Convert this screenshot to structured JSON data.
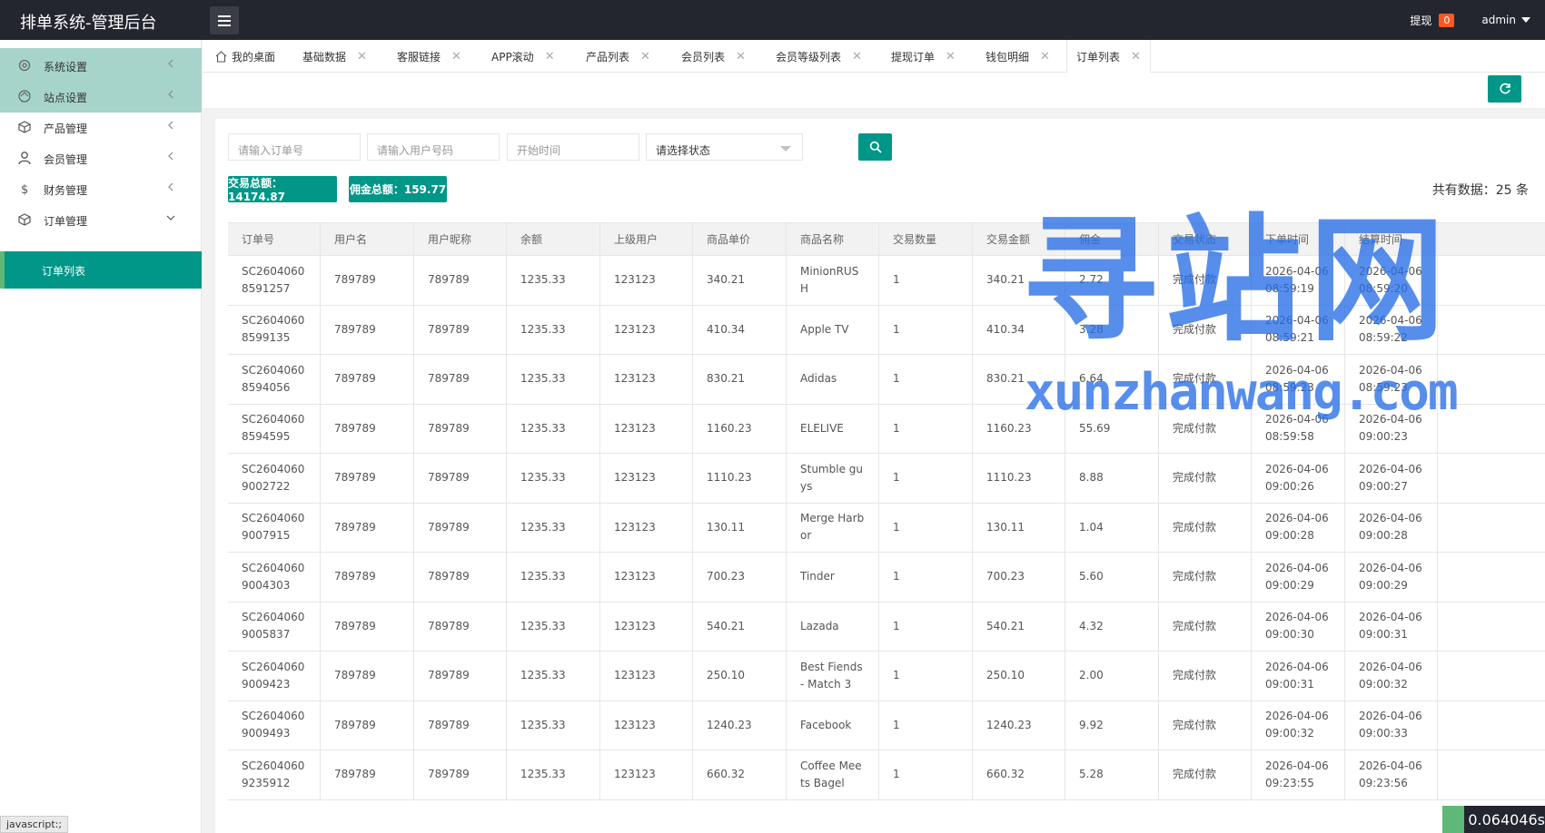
{
  "app": {
    "title": "排单系统-管理后台"
  },
  "header": {
    "withdraw_label": "提现",
    "withdraw_count": "0",
    "user": "admin"
  },
  "sidebar": {
    "items": [
      {
        "label": "系统设置",
        "icon": "gear-icon"
      },
      {
        "label": "站点设置",
        "icon": "site-icon"
      },
      {
        "label": "产品管理",
        "icon": "box-icon"
      },
      {
        "label": "会员管理",
        "icon": "user-icon"
      },
      {
        "label": "财务管理",
        "icon": "dollar-icon"
      },
      {
        "label": "订单管理",
        "icon": "box-icon"
      }
    ],
    "active_sub": "订单列表"
  },
  "tabs": [
    "我的桌面",
    "基础数据",
    "客服链接",
    "APP滚动",
    "产品列表",
    "会员列表",
    "会员等级列表",
    "提现订单",
    "钱包明细",
    "订单列表"
  ],
  "filters": {
    "order_no_placeholder": "请输入订单号",
    "phone_placeholder": "请输入用户号码",
    "start_placeholder": "开始时间",
    "status_value": "请选择状态"
  },
  "summary": {
    "trade_total": "交易总额：14174.87",
    "commission_total": "佣金总额：159.77",
    "count": "共有数据：25 条"
  },
  "table": {
    "headers": [
      "订单号",
      "用户名",
      "用户昵称",
      "余额",
      "上级用户",
      "商品单价",
      "商品名称",
      "交易数量",
      "交易金额",
      "佣金",
      "交易状态",
      "下单时间",
      "结算时间"
    ],
    "rows": [
      [
        "SC26040608591257",
        "789789",
        "789789",
        "1235.33",
        "123123",
        "340.21",
        "MinionRUSH",
        "1",
        "340.21",
        "2.72",
        "完成付款",
        "2026-04-06 08:59:19",
        "2026-04-06 08:59:20"
      ],
      [
        "SC26040608599135",
        "789789",
        "789789",
        "1235.33",
        "123123",
        "410.34",
        "Apple TV",
        "1",
        "410.34",
        "3.28",
        "完成付款",
        "2026-04-06 08:59:21",
        "2026-04-06 08:59:22"
      ],
      [
        "SC26040608594056",
        "789789",
        "789789",
        "1235.33",
        "123123",
        "830.21",
        "Adidas",
        "1",
        "830.21",
        "6.64",
        "完成付款",
        "2026-04-06 08:59:23",
        "2026-04-06 08:59:23"
      ],
      [
        "SC26040608594595",
        "789789",
        "789789",
        "1235.33",
        "123123",
        "1160.23",
        "ELELIVE",
        "1",
        "1160.23",
        "55.69",
        "完成付款",
        "2026-04-06 08:59:58",
        "2026-04-06 09:00:23"
      ],
      [
        "SC26040609002722",
        "789789",
        "789789",
        "1235.33",
        "123123",
        "1110.23",
        "Stumble guys",
        "1",
        "1110.23",
        "8.88",
        "完成付款",
        "2026-04-06 09:00:26",
        "2026-04-06 09:00:27"
      ],
      [
        "SC26040609007915",
        "789789",
        "789789",
        "1235.33",
        "123123",
        "130.11",
        "Merge Harbor",
        "1",
        "130.11",
        "1.04",
        "完成付款",
        "2026-04-06 09:00:28",
        "2026-04-06 09:00:28"
      ],
      [
        "SC26040609004303",
        "789789",
        "789789",
        "1235.33",
        "123123",
        "700.23",
        "Tinder",
        "1",
        "700.23",
        "5.60",
        "完成付款",
        "2026-04-06 09:00:29",
        "2026-04-06 09:00:29"
      ],
      [
        "SC26040609005837",
        "789789",
        "789789",
        "1235.33",
        "123123",
        "540.21",
        "Lazada",
        "1",
        "540.21",
        "4.32",
        "完成付款",
        "2026-04-06 09:00:30",
        "2026-04-06 09:00:31"
      ],
      [
        "SC26040609009423",
        "789789",
        "789789",
        "1235.33",
        "123123",
        "250.10",
        "Best Fiends - Match 3",
        "1",
        "250.10",
        "2.00",
        "完成付款",
        "2026-04-06 09:00:31",
        "2026-04-06 09:00:32"
      ],
      [
        "SC26040609009493",
        "789789",
        "789789",
        "1235.33",
        "123123",
        "1240.23",
        "Facebook",
        "1",
        "1240.23",
        "9.92",
        "完成付款",
        "2026-04-06 09:00:32",
        "2026-04-06 09:00:33"
      ],
      [
        "SC26040609235912",
        "789789",
        "789789",
        "1235.33",
        "123123",
        "660.32",
        "Coffee Meets Bagel",
        "1",
        "660.32",
        "5.28",
        "完成付款",
        "2026-04-06 09:23:55",
        "2026-04-06 09:23:56"
      ]
    ]
  },
  "watermark": {
    "big": "寻站网",
    "small": "xunzhanwang.com"
  },
  "statusbar": {
    "tip": "javascript:;",
    "timer": "0.064046s"
  },
  "colors": {
    "primary": "#009688",
    "header": "#23262e",
    "badge": "#ff5722",
    "sidebar_highlight": "#a6d4cb"
  }
}
